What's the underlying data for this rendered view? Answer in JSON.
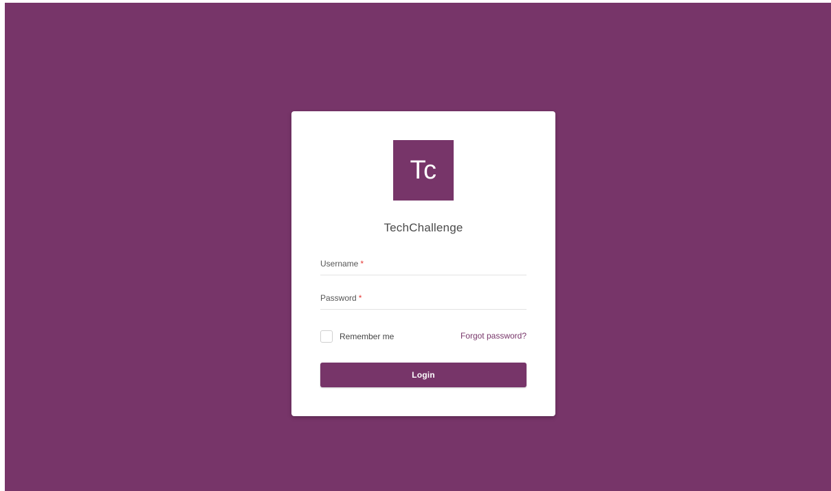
{
  "theme": {
    "background_color": "#773569",
    "accent_color": "#773569",
    "required_color": "#e53935"
  },
  "logo": {
    "text": "Tc"
  },
  "app": {
    "name": "TechChallenge"
  },
  "form": {
    "username": {
      "label": "Username",
      "required_marker": "*",
      "value": ""
    },
    "password": {
      "label": "Password",
      "required_marker": "*",
      "value": ""
    },
    "remember_me": {
      "label": "Remember me",
      "checked": false
    },
    "forgot_password_label": "Forgot password?",
    "login_label": "Login"
  }
}
